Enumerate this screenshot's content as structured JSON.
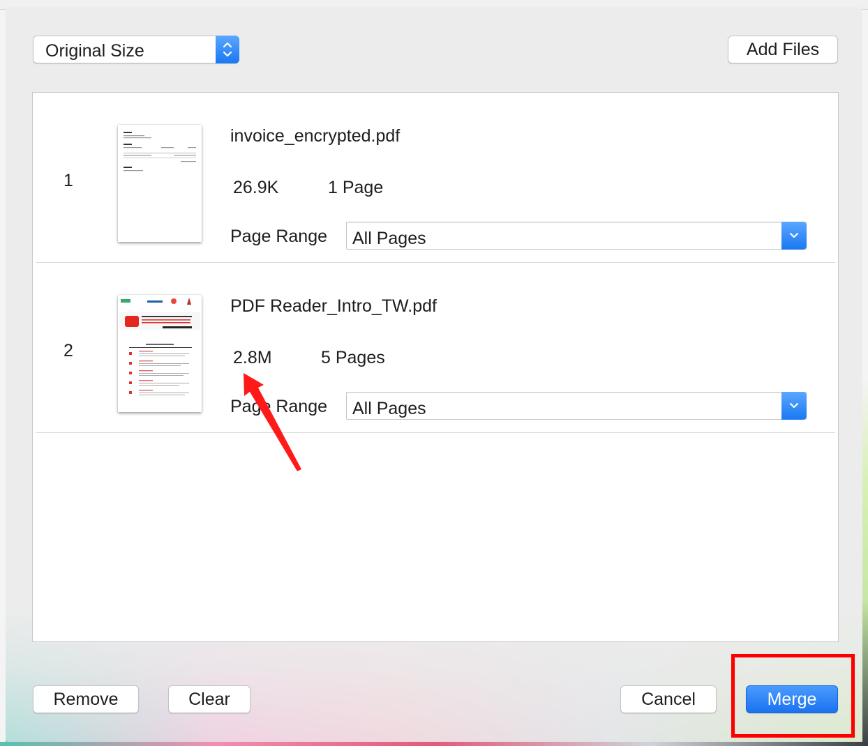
{
  "toolbar": {
    "size_popup": {
      "selected": "Original Size"
    },
    "add_files_label": "Add Files"
  },
  "files": [
    {
      "index": "1",
      "name": "invoice_encrypted.pdf",
      "size": "26.9K",
      "pages": "1 Page",
      "range_label": "Page Range",
      "range_value": "All Pages",
      "thumbnail": "invoice-document"
    },
    {
      "index": "2",
      "name": "PDF Reader_Intro_TW.pdf",
      "size": "2.8M",
      "pages": "5 Pages",
      "range_label": "Page Range",
      "range_value": "All Pages",
      "thumbnail": "pdf-reader-brochure"
    }
  ],
  "footer": {
    "remove_label": "Remove",
    "clear_label": "Clear",
    "cancel_label": "Cancel",
    "merge_label": "Merge"
  },
  "annotations": {
    "arrow_color": "#ff1a1a",
    "highlight_color": "#ff0000"
  },
  "colors": {
    "accent": "#1a78f2"
  }
}
